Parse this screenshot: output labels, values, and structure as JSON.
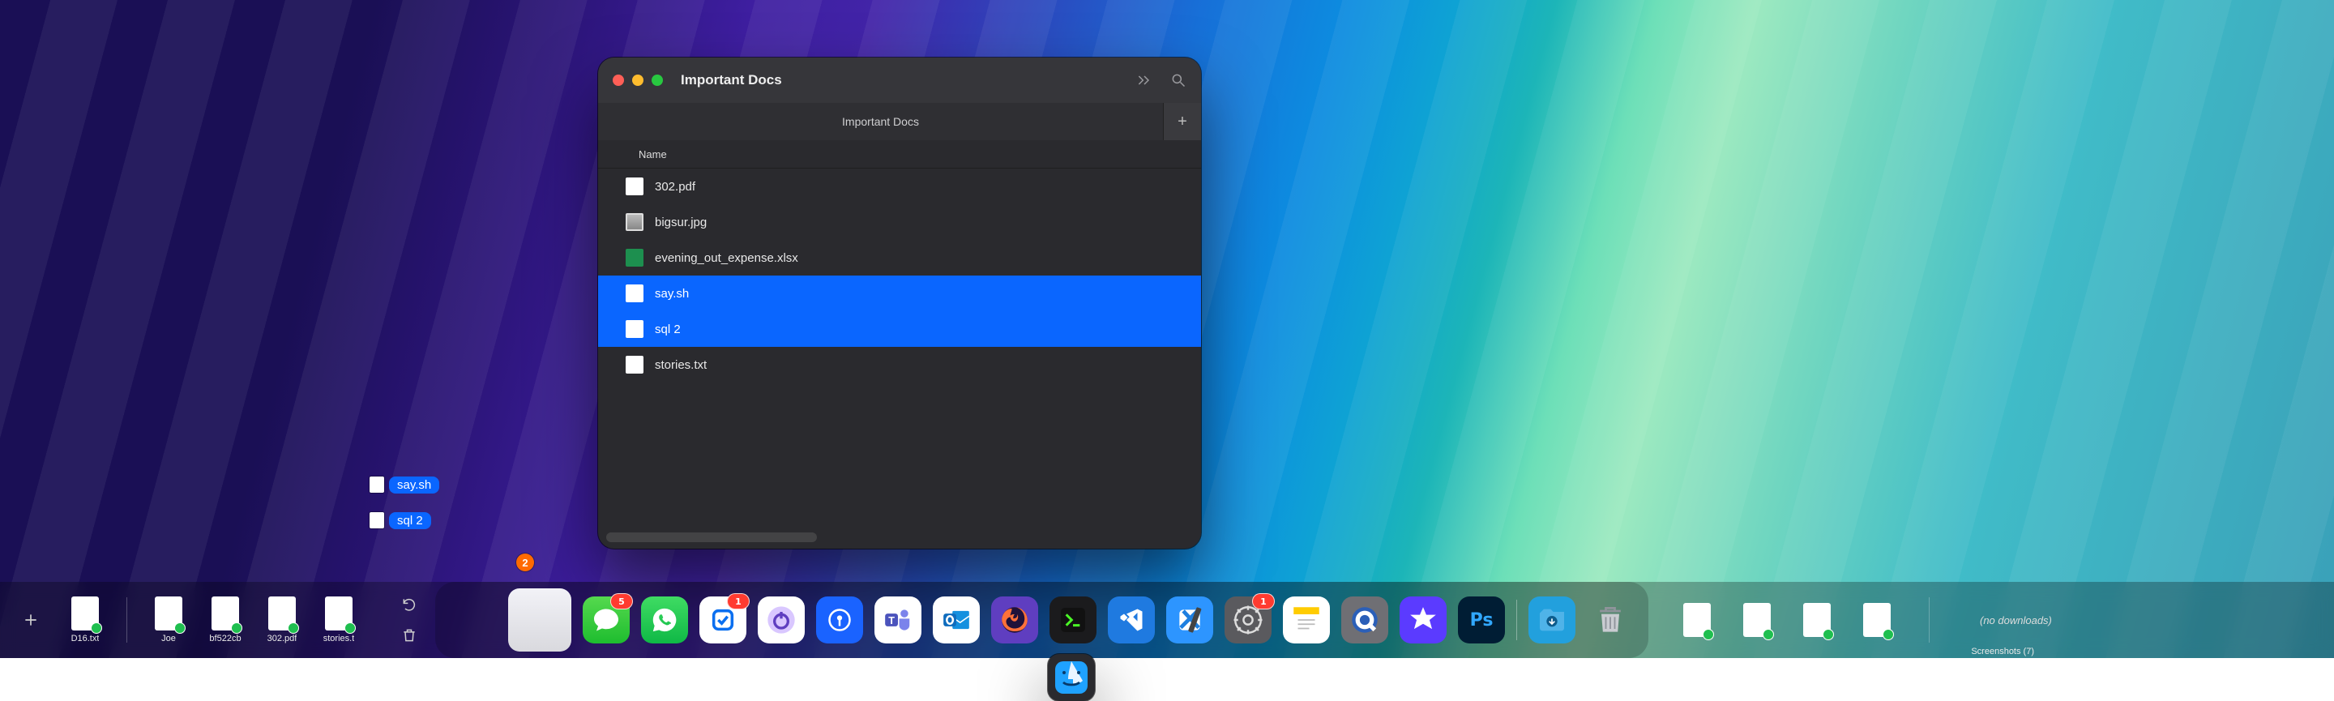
{
  "finder": {
    "title": "Important Docs",
    "tab_label": "Important Docs",
    "column_name": "Name",
    "newtab_glyph": "+",
    "rows": [
      {
        "name": "302.pdf",
        "icon": "pdf",
        "selected": false
      },
      {
        "name": "bigsur.jpg",
        "icon": "image",
        "selected": false
      },
      {
        "name": "evening_out_expense.xlsx",
        "icon": "xls",
        "selected": false
      },
      {
        "name": "say.sh",
        "icon": "plain",
        "selected": true
      },
      {
        "name": "sql 2",
        "icon": "plain",
        "selected": true
      },
      {
        "name": "stories.txt",
        "icon": "plain",
        "selected": false
      }
    ]
  },
  "drag": {
    "items": [
      {
        "name": "say.sh"
      },
      {
        "name": "sql 2"
      }
    ],
    "count": "2"
  },
  "shelf_left": {
    "files": [
      "D16.txt",
      "Joe",
      "bf522cb",
      "302.pdf",
      "stories.t"
    ]
  },
  "dock": {
    "apps": [
      {
        "id": "finder",
        "name": "Finder"
      },
      {
        "id": "launchpad",
        "name": "Launchpad"
      },
      {
        "id": "messages",
        "name": "Messages",
        "badge": "5"
      },
      {
        "id": "whatsapp",
        "name": "WhatsApp"
      },
      {
        "id": "things",
        "name": "Things",
        "badge": "1"
      },
      {
        "id": "toggl",
        "name": "Toggl"
      },
      {
        "id": "onepw",
        "name": "1Password"
      },
      {
        "id": "teams",
        "name": "Teams"
      },
      {
        "id": "outlook",
        "name": "Outlook"
      },
      {
        "id": "firefox",
        "name": "Firefox"
      },
      {
        "id": "iterm",
        "name": "iTerm"
      },
      {
        "id": "vscode",
        "name": "VS Code"
      },
      {
        "id": "xcode",
        "name": "Xcode"
      },
      {
        "id": "settings",
        "name": "System Settings",
        "badge": "1"
      },
      {
        "id": "notes",
        "name": "Notes"
      },
      {
        "id": "quicktime",
        "name": "QuickTime"
      },
      {
        "id": "imovie",
        "name": "iMovie"
      },
      {
        "id": "ps",
        "name": "Photoshop",
        "label": "Ps"
      }
    ],
    "folders": [
      {
        "id": "downloads",
        "name": "Downloads"
      }
    ],
    "trash": "Trash"
  },
  "stacks": {
    "label": "Screenshots (7)",
    "count": 4
  },
  "nodownloads": "(no downloads)"
}
